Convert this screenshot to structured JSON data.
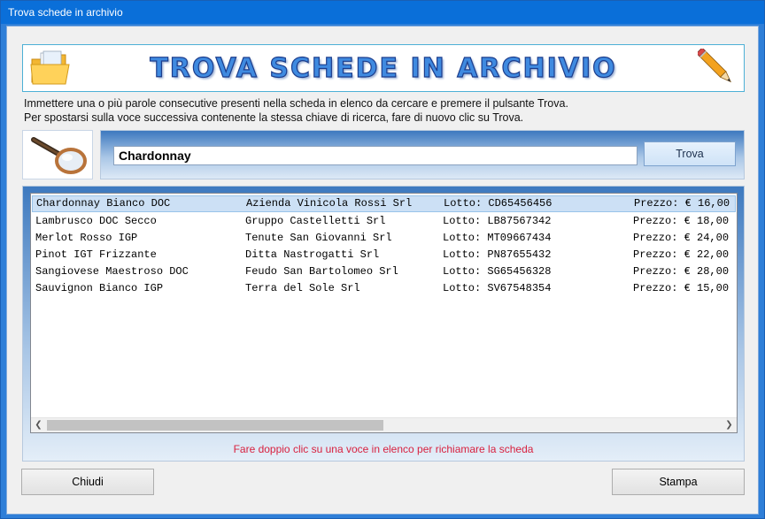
{
  "window": {
    "title": "Trova schede in archivio"
  },
  "banner": {
    "title": "TROVA SCHEDE IN ARCHIVIO"
  },
  "instructions": {
    "line1": "Immettere una o più parole consecutive presenti nella scheda in elenco da cercare e premere il pulsante Trova.",
    "line2": "Per spostarsi sulla voce successiva contenente la stessa chiave di ricerca, fare di nuovo clic su Trova."
  },
  "search": {
    "value": "Chardonnay",
    "button_label": "Trova"
  },
  "results": {
    "rows": [
      {
        "name": "Chardonnay Bianco DOC",
        "company": "Azienda Vinicola Rossi Srl",
        "lot": "Lotto: CD65456456",
        "price": "Prezzo: € 16,00",
        "selected": true
      },
      {
        "name": "Lambrusco DOC Secco",
        "company": "Gruppo Castelletti Srl",
        "lot": "Lotto: LB87567342",
        "price": "Prezzo: € 18,00",
        "selected": false
      },
      {
        "name": "Merlot Rosso IGP",
        "company": "Tenute San Giovanni Srl",
        "lot": "Lotto: MT09667434",
        "price": "Prezzo: € 24,00",
        "selected": false
      },
      {
        "name": "Pinot IGT Frizzante",
        "company": "Ditta Nastrogatti Srl",
        "lot": "Lotto: PN87655432",
        "price": "Prezzo: € 22,00",
        "selected": false
      },
      {
        "name": "Sangiovese Maestroso DOC",
        "company": "Feudo San Bartolomeo Srl",
        "lot": "Lotto: SG65456328",
        "price": "Prezzo: € 28,00",
        "selected": false
      },
      {
        "name": "Sauvignon Bianco IGP",
        "company": "Terra del Sole Srl",
        "lot": "Lotto: SV67548354",
        "price": "Prezzo: € 15,00",
        "selected": false
      }
    ],
    "hint": "Fare doppio clic su una voce in elenco per richiamare la scheda"
  },
  "footer": {
    "close_label": "Chiudi",
    "print_label": "Stampa"
  },
  "icons": {
    "folder": "folder-icon",
    "pencil": "pencil-icon",
    "magnifier": "magnifier-icon",
    "scroll_left": "chevron-left-icon",
    "scroll_right": "chevron-right-icon"
  },
  "colors": {
    "title_bar": "#0a6fd9",
    "hint_text": "#d8213f",
    "selected_row": "#cce0f5"
  }
}
